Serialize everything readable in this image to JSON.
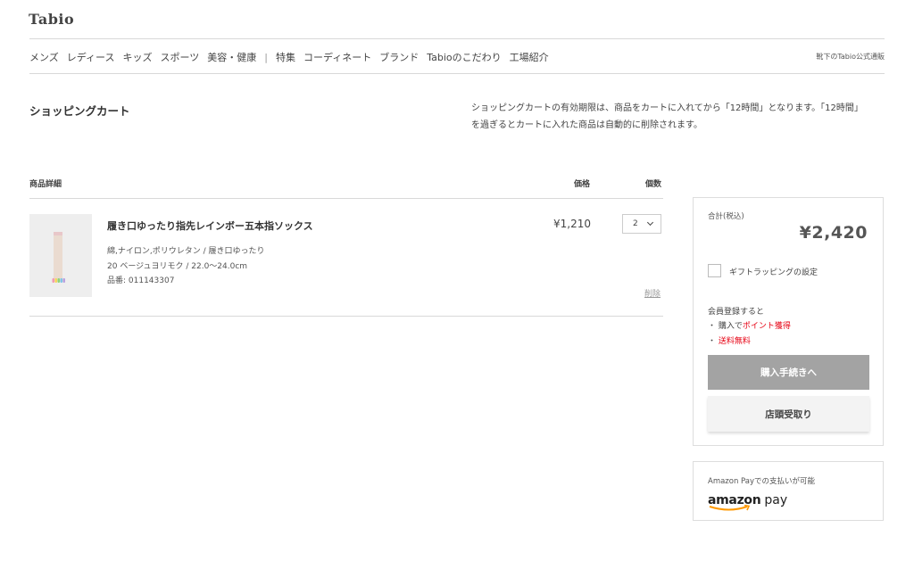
{
  "header": {
    "logo": "Tabio",
    "official_link": "靴下のTabio公式通販"
  },
  "nav": {
    "items": [
      "メンズ",
      "レディース",
      "キッズ",
      "スポーツ",
      "美容・健康"
    ],
    "separator": "|",
    "items2": [
      "特集",
      "コーディネート",
      "ブランド",
      "Tabioのこだわり",
      "工場紹介"
    ]
  },
  "page": {
    "title": "ショッピングカート",
    "notice_line1": "ショッピングカートの有効期限は、商品をカートに入れてから「12時間」となります。「12時間」",
    "notice_line2": "を過ぎるとカートに入れた商品は自動的に削除されます。"
  },
  "table": {
    "col_detail": "商品詳細",
    "col_price": "価格",
    "col_qty": "個数"
  },
  "item": {
    "name": "履き口ゆったり指先レインボー五本指ソックス",
    "material": "綿,ナイロン,ポリウレタン / 履き口ゆったり",
    "color_size": "20 ベージュヨリモク / 22.0〜24.0cm",
    "sku": "品番: 011143307",
    "price": "¥1,210",
    "qty": "2",
    "delete_label": "削除"
  },
  "summary": {
    "total_label": "合計(税込)",
    "total_value": "¥2,420",
    "gift_label": "ギフトラッピングの設定",
    "member_intro": "会員登録すると",
    "benefit1_prefix": "・ 購入で",
    "benefit1_red": "ポイント獲得",
    "benefit2_prefix": "・ ",
    "benefit2_red": "送料無料",
    "checkout_button": "購入手続きへ",
    "store_pickup_button": "店頭受取り"
  },
  "amazon": {
    "text": "Amazon Payでの支払いが可能",
    "logo_word1": "amazon",
    "logo_word2": "pay"
  },
  "colors": {
    "accent_red": "#e60012",
    "checkout_bg": "#a3a3a3",
    "amazon_orange": "#ff9900"
  }
}
